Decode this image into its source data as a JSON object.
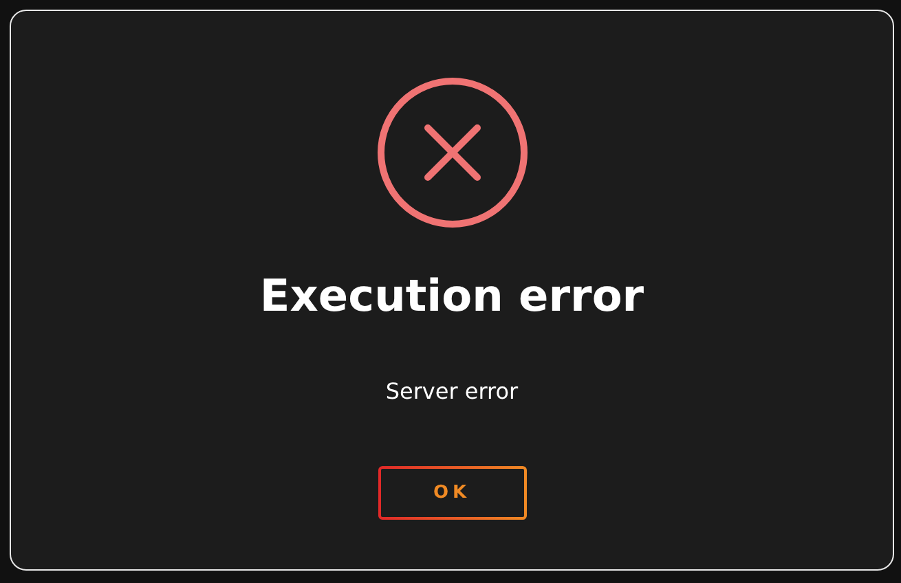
{
  "dialog": {
    "icon": {
      "kind": "error"
    },
    "title": "Execution error",
    "message": "Server error",
    "buttons": [
      {
        "label": "OK"
      }
    ]
  }
}
